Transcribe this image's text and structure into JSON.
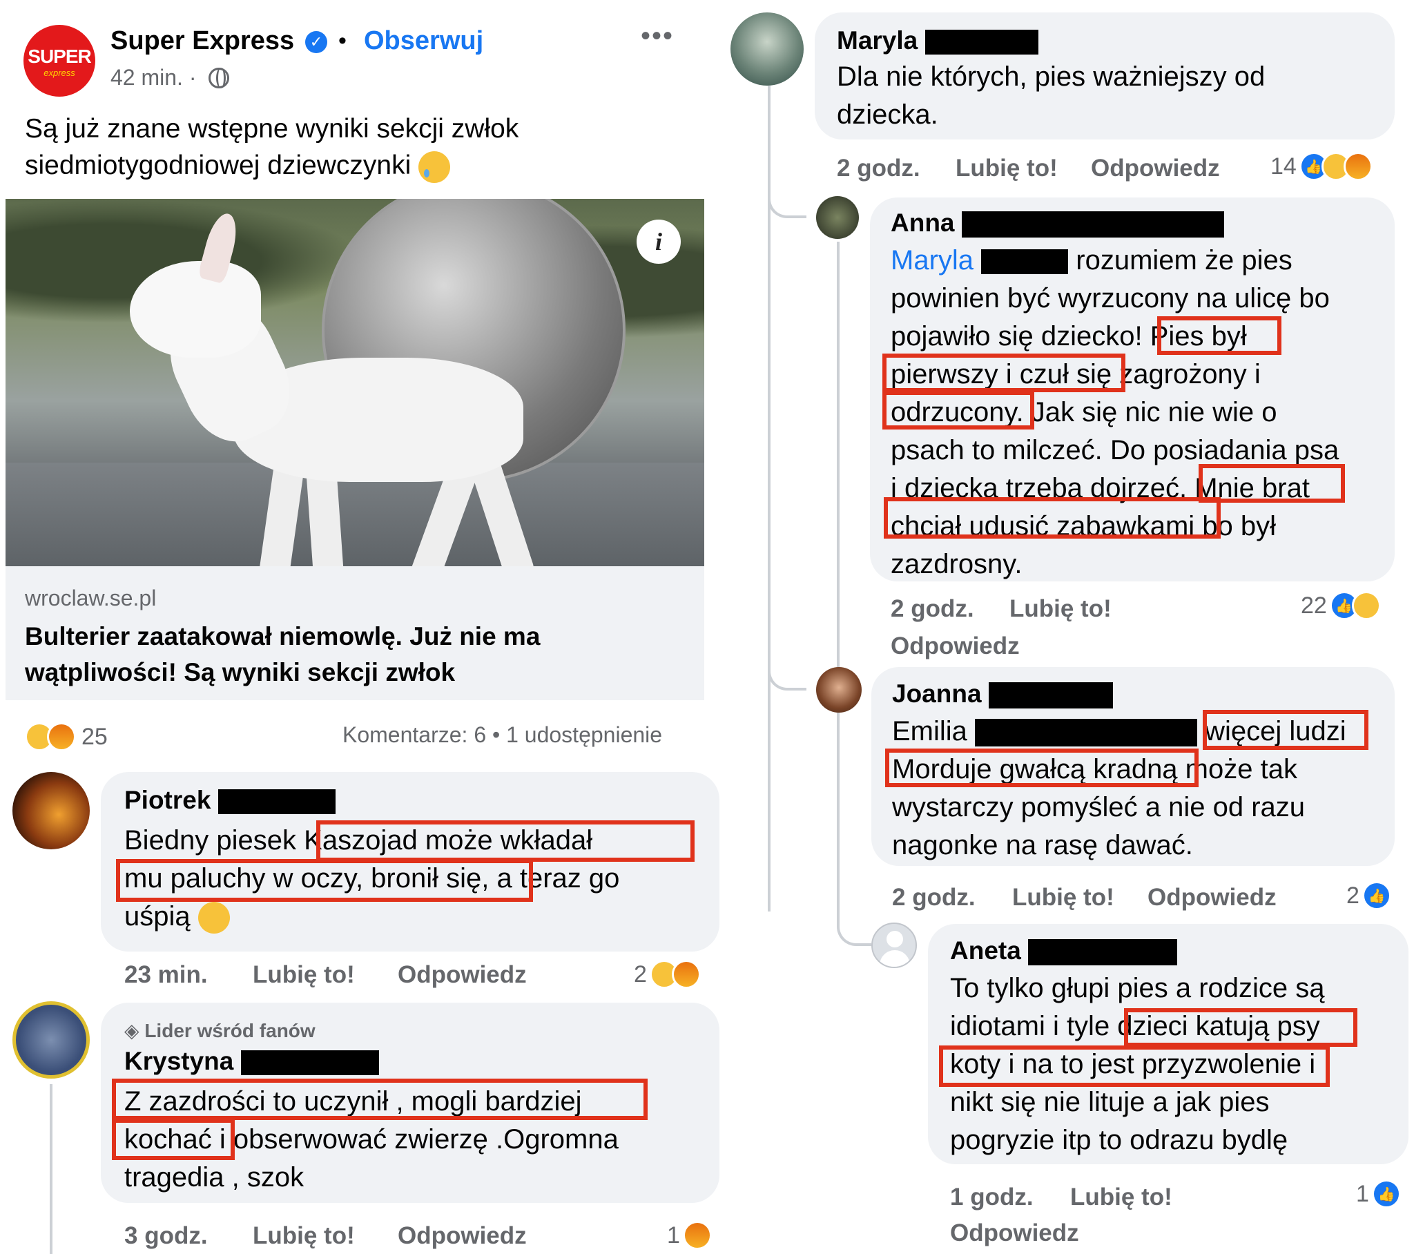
{
  "post": {
    "page_name": "Super Express",
    "logo_text": "SUPER",
    "logo_sub": "express",
    "follow_label": "Obserwuj",
    "more_label": "•••",
    "time": "42 min. ·",
    "text": "Są już znane wstępne wyniki sekcji zwłok siedmiotygodniowej dziewczynki",
    "link": {
      "domain": "wroclaw.se.pl",
      "title": "Bulterier zaatakował niemowlę. Już nie ma wątpliwości! Są wyniki sekcji zwłok"
    },
    "info_label": "i",
    "reaction_count": "25",
    "comments_summary": "Komentarze: 6 • 1 udostępnienie"
  },
  "comments": [
    {
      "name": "Piotrek",
      "text": "Biedny piesek Kaszojad może wkładał mu paluchy w oczy, bronił się, a teraz go uśpią",
      "time": "23 min.",
      "like": "Lubię to!",
      "reply": "Odpowiedz",
      "reactions": "2"
    },
    {
      "badge": "Lider wśród fanów",
      "name": "Krystyna",
      "text": "Z zazdrości to uczynił , mogli bardziej kochać i obserwować zwierzę .Ogromna tragedia , szok",
      "time": "3 godz.",
      "like": "Lubię to!",
      "reply": "Odpowiedz",
      "reactions": "1"
    },
    {
      "name": "Maryla",
      "text": "Dla nie których, pies ważniejszy od dziecka.",
      "time": "2 godz.",
      "like": "Lubię to!",
      "reply": "Odpowiedz",
      "reactions": "14"
    },
    {
      "name": "Anna",
      "mention": "Maryla",
      "text": "rozumiem że pies powinien być wyrzucony na ulicę bo pojawiło się dziecko! Pies był pierwszy i czuł się zagrożony i odrzucony. Jak się nic nie wie o psach to milczeć. Do posiadania psa i dziecka trzeba dojrzeć. Mnie brat chciał udusić zabawkami bo był zazdrosny.",
      "time": "2 godz.",
      "like": "Lubię to!",
      "reply": "Odpowiedz",
      "reactions": "22"
    },
    {
      "name": "Joanna",
      "text": "Emilia więcej ludzi Morduje gwałcą kradną może tak wystarczy pomyśleć a nie od razu nagonke na rasę dawać.",
      "time": "2 godz.",
      "like": "Lubię to!",
      "reply": "Odpowiedz",
      "reactions": "2"
    },
    {
      "name": "Aneta",
      "text": "To tylko głupi pies a rodzice są idiotami i tyle dzieci katują psy koty i na to jest przyzwolenie i nikt się nie lituje a jak pies pogryzie itp to odrazu bydlę",
      "time": "1 godz.",
      "like": "Lubię to!",
      "reply": "Odpowiedz",
      "reactions": "1"
    }
  ],
  "lines": {
    "post": [
      "Są już znane wstępne wyniki sekcji zwłok",
      "siedmiotygodniowej dziewczynki"
    ],
    "link_title": [
      "Bulterier zaatakował niemowlę. Już nie ma",
      "wątpliwości! Są wyniki sekcji zwłok"
    ],
    "piotrek": [
      "Biedny piesek Kaszojad może wkładał",
      "mu paluchy w oczy, bronił się, a teraz go",
      "uśpią"
    ],
    "krystyna": [
      "Z zazdrości to uczynił , mogli bardziej",
      "kochać i obserwować zwierzę .Ogromna",
      "tragedia , szok"
    ],
    "maryla": [
      "Dla nie których, pies ważniejszy od",
      "dziecka."
    ],
    "anna": [
      "rozumiem że pies",
      "powinien być wyrzucony na ulicę bo",
      "pojawiło się dziecko! Pies był",
      "pierwszy i czuł się zagrożony i",
      "odrzucony. Jak się nic nie wie o",
      "psach to milczeć. Do posiadania psa",
      "i dziecka trzeba dojrzeć. Mnie brat",
      "chciał udusić zabawkami bo był",
      "zazdrosny."
    ],
    "joanna": [
      "Emilia",
      "więcej ludzi",
      "Morduje gwałcą kradną może tak",
      "wystarczy pomyśleć a nie od razu",
      "nagonke na rasę dawać."
    ],
    "aneta": [
      "To tylko głupi pies a rodzice są",
      "idiotami i tyle dzieci katują psy",
      "koty i na to jest przyzwolenie i",
      "nikt się nie lituje a jak pies",
      "pogryzie itp to odrazu bydlę"
    ]
  },
  "colors": {
    "accent": "#1877f2",
    "highlight_box": "#e0321b",
    "bubble": "#f0f2f5",
    "meta_text": "#65676b",
    "brand_red": "#e3191b"
  },
  "icons": [
    "verified-badge-icon",
    "globe-icon",
    "more-icon",
    "info-icon",
    "sad-reaction-icon",
    "angry-reaction-icon",
    "haha-reaction-icon",
    "like-reaction-icon",
    "fan-badge-icon",
    "default-avatar-icon"
  ]
}
